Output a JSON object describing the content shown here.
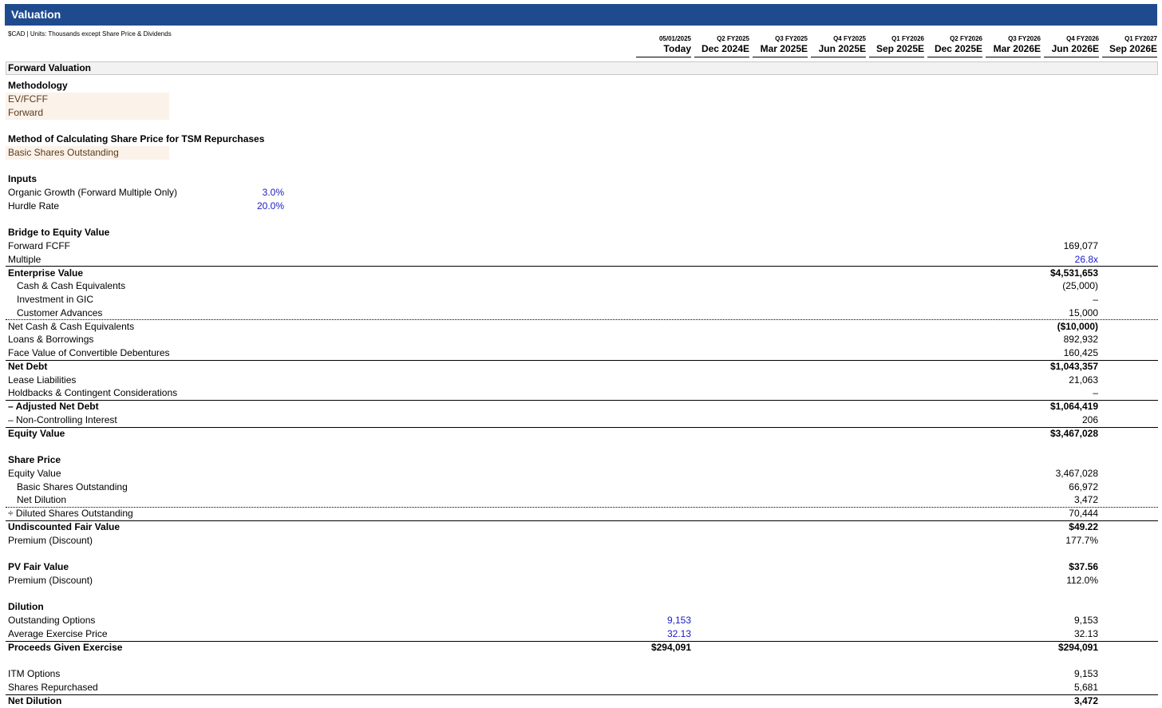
{
  "title": "Valuation",
  "units_note": "$CAD | Units: Thousands except Share Price & Dividends",
  "columns": [
    {
      "date": "05/01/2025",
      "period": "Today"
    },
    {
      "date": "Q2 FY2025",
      "period": "Dec 2024E"
    },
    {
      "date": "Q3 FY2025",
      "period": "Mar 2025E"
    },
    {
      "date": "Q4 FY2025",
      "period": "Jun 2025E"
    },
    {
      "date": "Q1 FY2026",
      "period": "Sep 2025E"
    },
    {
      "date": "Q2 FY2026",
      "period": "Dec 2025E"
    },
    {
      "date": "Q3 FY2026",
      "period": "Mar 2026E"
    },
    {
      "date": "Q4 FY2026",
      "period": "Jun 2026E"
    },
    {
      "date": "Q1 FY2027",
      "period": "Sep 2026E"
    }
  ],
  "section_title": "Forward Valuation",
  "methodology": {
    "heading": "Methodology",
    "option1": "EV/FCFF",
    "option2": "Forward"
  },
  "repurchase": {
    "heading": "Method of Calculating Share Price for TSM Repurchases",
    "option": "Basic Shares Outstanding"
  },
  "inputs": {
    "heading": "Inputs",
    "organic_growth_label": "Organic Growth (Forward Multiple Only)",
    "organic_growth_value": "3.0%",
    "hurdle_label": "Hurdle Rate",
    "hurdle_value": "20.0%"
  },
  "bridge": {
    "heading": "Bridge to Equity Value",
    "forward_fcff_label": "Forward FCFF",
    "forward_fcff": "169,077",
    "multiple_label": "Multiple",
    "multiple": "26.8x",
    "ev_label": "Enterprise Value",
    "ev": "$4,531,653",
    "cash_label": "Cash & Cash Equivalents",
    "cash": "(25,000)",
    "gic_label": "Investment in GIC",
    "gic": "–",
    "advances_label": "Customer Advances",
    "advances": "15,000",
    "net_cash_label": "Net Cash & Cash Equivalents",
    "net_cash": "($10,000)",
    "loans_label": "Loans & Borrowings",
    "loans": "892,932",
    "convert_label": "Face Value of Convertible Debentures",
    "convert": "160,425",
    "net_debt_label": "Net Debt",
    "net_debt": "$1,043,357",
    "lease_label": "Lease Liabilities",
    "lease": "21,063",
    "holdbacks_label": "Holdbacks & Contingent Considerations",
    "holdbacks": "–",
    "adj_net_debt_label": "– Adjusted Net Debt",
    "adj_net_debt": "$1,064,419",
    "nci_label": "– Non-Controlling Interest",
    "nci": "206",
    "equity_label": "Equity Value",
    "equity": "$3,467,028"
  },
  "share_price": {
    "heading": "Share Price",
    "equity_label": "Equity Value",
    "equity": "3,467,028",
    "basic_label": "Basic Shares Outstanding",
    "basic": "66,972",
    "dilution_label": "Net Dilution",
    "dilution": "3,472",
    "diluted_label": "÷ Diluted Shares Outstanding",
    "diluted": "70,444",
    "fair_label": "Undiscounted Fair Value",
    "fair": "$49.22",
    "premium_label": "Premium (Discount)",
    "premium": "177.7%",
    "pv_label": "PV Fair Value",
    "pv": "$37.56",
    "pv_premium_label": "Premium (Discount)",
    "pv_premium": "112.0%"
  },
  "dilution": {
    "heading": "Dilution",
    "options_label": "Outstanding Options",
    "options_today": "9,153",
    "options": "9,153",
    "price_label": "Average Exercise Price",
    "price_today": "32.13",
    "price": "32.13",
    "proceeds_label": "Proceeds Given Exercise",
    "proceeds_today": "$294,091",
    "proceeds": "$294,091",
    "itm_label": "ITM Options",
    "itm": "9,153",
    "repurchased_label": "Shares Repurchased",
    "repurchased": "5,681",
    "net_label": "Net Dilution",
    "net": "3,472"
  }
}
